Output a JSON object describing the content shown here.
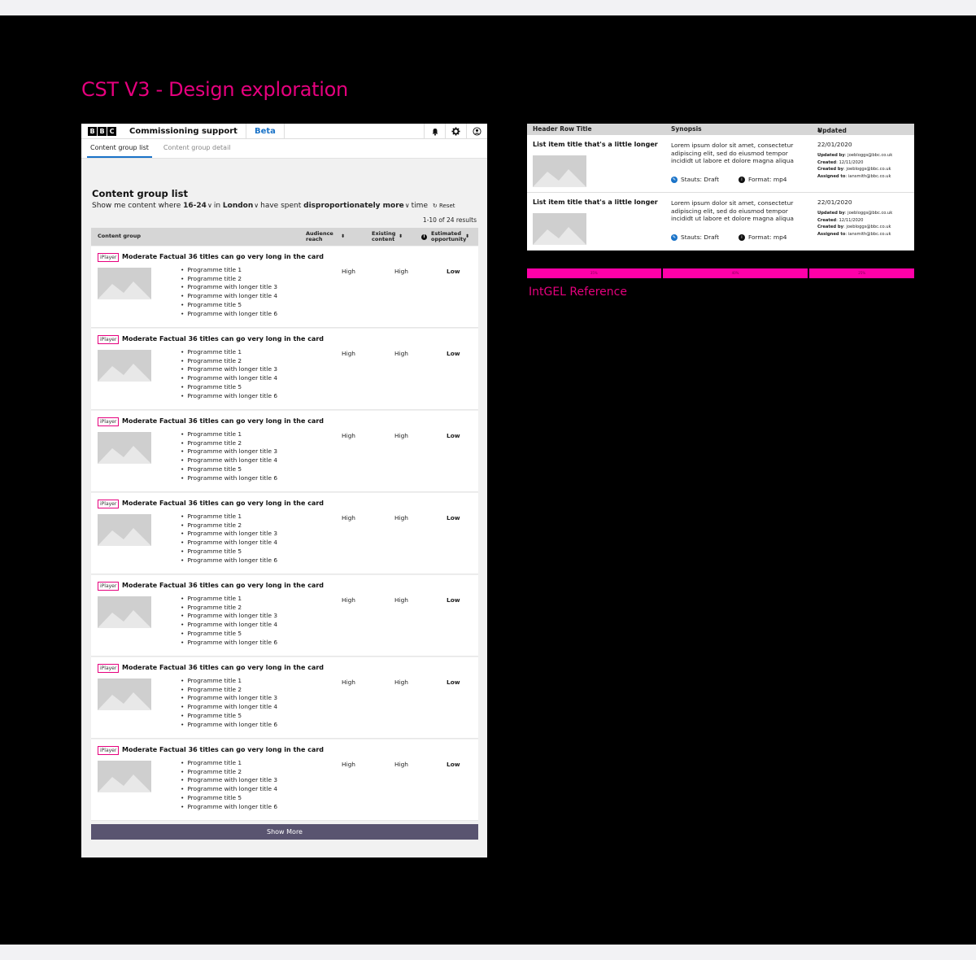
{
  "page_title": "CST V3 - Design exploration",
  "app": {
    "logo": [
      "B",
      "B",
      "C"
    ],
    "name": "Commissioning support",
    "beta": "Beta",
    "icons": [
      "bell-icon",
      "gear-icon",
      "user-icon"
    ],
    "tabs": [
      "Content group list",
      "Content group detail"
    ],
    "heading": "Content group list",
    "filter": {
      "prefix": "Show me content where",
      "age": "16-24",
      "in": "in",
      "location": "London",
      "have_spent": "have spent",
      "spend": "disproportionately more",
      "time": "time",
      "reset": "Reset"
    },
    "results": "1-10 of 24 results",
    "columns": {
      "group": "Content group",
      "reach": "Audience reach",
      "existing": "Existing content",
      "opportunity": "Estimated opportunity"
    },
    "rows": [
      {
        "badge": "iPlayer",
        "title": "Moderate Factual 36 titles can go very long in the card",
        "programmes": [
          "Programme title 1",
          "Programme title 2",
          "Programme with longer title 3",
          "Programme with longer title 4",
          "Programme title 5",
          "Programme with longer title 6"
        ],
        "reach": "High",
        "existing": "High",
        "opportunity": "Low"
      },
      {
        "badge": "iPlayer",
        "title": "Moderate Factual 36 titles can go very long in the card",
        "programmes": [
          "Programme title 1",
          "Programme title 2",
          "Programme with longer title 3",
          "Programme with longer title 4",
          "Programme title 5",
          "Programme with longer title 6"
        ],
        "reach": "High",
        "existing": "High",
        "opportunity": "Low"
      },
      {
        "badge": "iPlayer",
        "title": "Moderate Factual 36 titles can go very long in the card",
        "programmes": [
          "Programme title 1",
          "Programme title 2",
          "Programme with longer title 3",
          "Programme with longer title 4",
          "Programme title 5",
          "Programme with longer title 6"
        ],
        "reach": "High",
        "existing": "High",
        "opportunity": "Low"
      },
      {
        "badge": "iPlayer",
        "title": "Moderate Factual 36 titles can go very long in the card",
        "programmes": [
          "Programme title 1",
          "Programme title 2",
          "Programme with longer title 3",
          "Programme with longer title 4",
          "Programme title 5",
          "Programme with longer title 6"
        ],
        "reach": "High",
        "existing": "High",
        "opportunity": "Low"
      },
      {
        "badge": "iPlayer",
        "title": "Moderate Factual 36 titles can go very long in the card",
        "programmes": [
          "Programme title 1",
          "Programme title 2",
          "Programme with longer title 3",
          "Programme with longer title 4",
          "Programme title 5",
          "Programme with longer title 6"
        ],
        "reach": "High",
        "existing": "High",
        "opportunity": "Low"
      },
      {
        "badge": "iPlayer",
        "title": "Moderate Factual 36 titles can go very long in the card",
        "programmes": [
          "Programme title 1",
          "Programme title 2",
          "Programme with longer title 3",
          "Programme with longer title 4",
          "Programme title 5",
          "Programme with longer title 6"
        ],
        "reach": "High",
        "existing": "High",
        "opportunity": "Low"
      },
      {
        "badge": "iPlayer",
        "title": "Moderate Factual 36 titles can go very long in the card",
        "programmes": [
          "Programme title 1",
          "Programme title 2",
          "Programme with longer title 3",
          "Programme with longer title 4",
          "Programme title 5",
          "Programme with longer title 6"
        ],
        "reach": "High",
        "existing": "High",
        "opportunity": "Low"
      }
    ],
    "show_more": "Show More"
  },
  "reference": {
    "headers": {
      "title": "Header Row Title",
      "synopsis": "Synopsis",
      "updated": "Updated"
    },
    "rows": [
      {
        "title": "List item title that's a little longer",
        "synopsis": "Lorem ipsum dolor sit amet, consectetur adipiscing elit, sed do eiusmod tempor incididt ut labore et dolore magna aliqua",
        "status": "Stauts: Draft",
        "format": "Format: mp4",
        "date": "22/01/2020",
        "updated_by_label": "Updated by",
        "updated_by": ": joebloggs@bbc.co.uk",
        "created_label": "Created",
        "created": ": 12/11/2020",
        "created_by_label": "Created by",
        "created_by": ": joebloggs@bbc.co.uk",
        "assigned_label": "Assigned to",
        "assigned": ": iansmith@bbc.co.uk"
      },
      {
        "title": "List item title that's a little longer",
        "synopsis": "Lorem ipsum dolor sit amet, consectetur adipiscing elit, sed do eiusmod tempor incididt ut labore et dolore magna aliqua",
        "status": "Stauts: Draft",
        "format": "Format: mp4",
        "date": "22/01/2020",
        "updated_by_label": "Updated by",
        "updated_by": ": joebloggs@bbc.co.uk",
        "created_label": "Created",
        "created": ": 12/11/2020",
        "created_by_label": "Created by",
        "created_by": ": joebloggs@bbc.co.uk",
        "assigned_label": "Assigned to",
        "assigned": ": iansmith@bbc.co.uk"
      }
    ],
    "bar_labels": [
      "35%",
      "40%",
      "25%"
    ],
    "caption": "IntGEL Reference"
  },
  "colors": {
    "accent": "#e6007e",
    "link": "#1a73c8",
    "button": "#595470",
    "guide": "#ff00a8"
  }
}
